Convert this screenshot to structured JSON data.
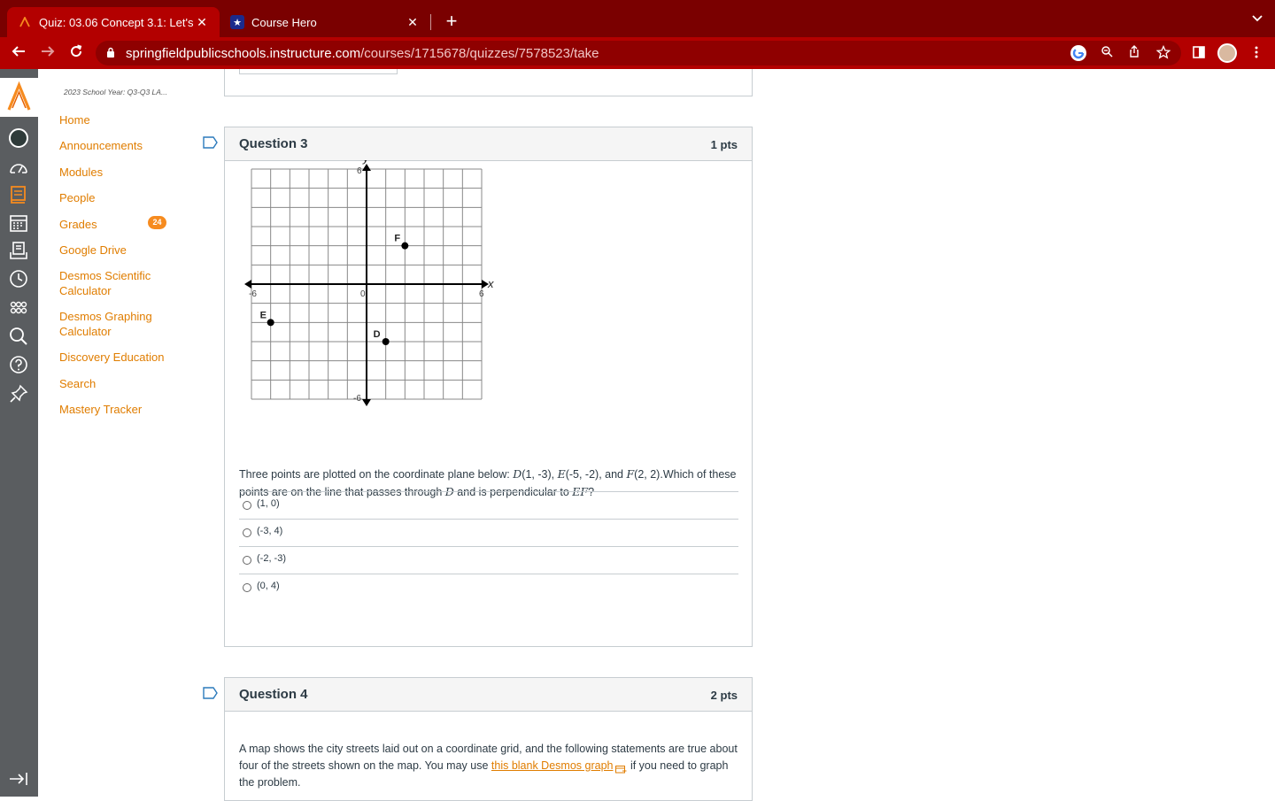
{
  "browser": {
    "tabs": [
      {
        "title": "Quiz: 03.06 Concept 3.1: Let's",
        "active": true,
        "favicon": "canvas-logo-icon"
      },
      {
        "title": "Course Hero",
        "active": false,
        "favicon": "star-icon"
      }
    ],
    "url_host": "springfieldpublicschools.instructure.com",
    "url_path": "/courses/1715678/quizzes/7578523/take",
    "accent_color": "#b30000"
  },
  "course_nav": {
    "course_title": "2023 School Year: Q3-Q3 LA...",
    "items": [
      {
        "label": "Home"
      },
      {
        "label": "Announcements"
      },
      {
        "label": "Modules"
      },
      {
        "label": "People"
      },
      {
        "label": "Grades",
        "badge": "24"
      },
      {
        "label": "Google Drive"
      },
      {
        "label": "Desmos Scientific Calculator"
      },
      {
        "label": "Desmos Graphing Calculator"
      },
      {
        "label": "Discovery Education"
      },
      {
        "label": "Search"
      },
      {
        "label": "Mastery Tracker"
      }
    ],
    "link_color": "#e07d00"
  },
  "global_nav": {
    "icons": [
      "canvas-logo-icon",
      "account-avatar",
      "dashboard-icon",
      "courses-icon",
      "calendar-icon",
      "inbox-icon",
      "history-icon",
      "commons-icon",
      "search-icon",
      "help-icon",
      "pin-icon",
      "collapse-nav-icon"
    ]
  },
  "question3": {
    "name": "Question 3",
    "points": "1 pts",
    "graph": {
      "x_label": "x",
      "y_label": "y",
      "x_min": -6,
      "x_max": 6,
      "y_min": -6,
      "y_max": 6,
      "tick_labels": {
        "x_min": "-6",
        "x_max": "6",
        "y_max": "6",
        "y_min": "-6",
        "origin": "0"
      },
      "points": [
        {
          "label": "F",
          "x": 2,
          "y": 2
        },
        {
          "label": "E",
          "x": -5,
          "y": -2
        },
        {
          "label": "D",
          "x": 1,
          "y": -3
        }
      ]
    },
    "text_pre": "Three points are plotted on the coordinate plane below: ",
    "text_D": "D",
    "text_D_coords": "(1, -3), ",
    "text_E": "E",
    "text_E_coords": "(-5, -2), and ",
    "text_F": "F",
    "text_F_coords": "(2, 2).Which of these points are on the line that passes through ",
    "text_D2": "D",
    "text_mid": " and is perpendicular to ",
    "text_EF": "EF",
    "text_end": "?",
    "answers": [
      "(1, 0)",
      "(-3, 4)",
      "(-2, -3)",
      "(0, 4)"
    ]
  },
  "question4": {
    "name": "Question 4",
    "points": "2 pts",
    "text_pre": "A map shows the city streets laid out on a coordinate grid, and the following statements are true about four of the streets shown on the map. You may use ",
    "link_text": "this blank Desmos graph",
    "text_post": " if you need to graph the problem."
  }
}
